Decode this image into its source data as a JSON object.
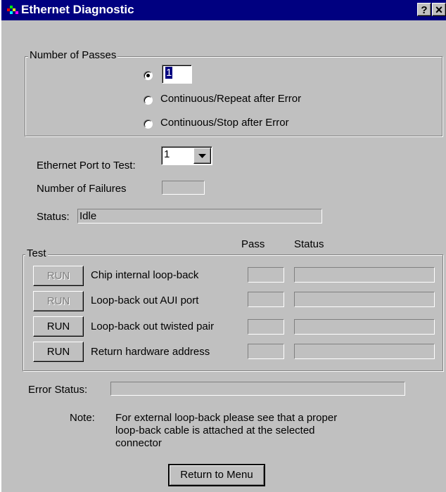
{
  "window": {
    "title": "Ethernet Diagnostic",
    "help_button": "?",
    "close_button": "×"
  },
  "passes": {
    "legend": "Number of Passes",
    "count_value": "1",
    "options": [
      {
        "label": "",
        "selected": true
      },
      {
        "label": "Continuous/Repeat after Error",
        "selected": false
      },
      {
        "label": "Continuous/Stop after  Error",
        "selected": false
      }
    ]
  },
  "port": {
    "label": "Ethernet Port to Test:",
    "selected": "1"
  },
  "failures": {
    "label": "Number of Failures",
    "value": ""
  },
  "status": {
    "label": "Status:",
    "value": "Idle"
  },
  "test": {
    "legend": "Test",
    "col_pass": "Pass",
    "col_status": "Status",
    "rows": [
      {
        "button": "RUN",
        "enabled": false,
        "label": "Chip internal loop-back",
        "pass": "",
        "status": ""
      },
      {
        "button": "RUN",
        "enabled": false,
        "label": "Loop-back out AUI port",
        "pass": "",
        "status": ""
      },
      {
        "button": "RUN",
        "enabled": true,
        "label": "Loop-back out twisted pair",
        "pass": "",
        "status": ""
      },
      {
        "button": "RUN",
        "enabled": true,
        "label": "Return hardware address",
        "pass": "",
        "status": ""
      }
    ]
  },
  "error_status": {
    "label": "Error Status:",
    "value": ""
  },
  "note": {
    "label": "Note:",
    "lines": [
      "For external loop-back please see that a proper",
      "loop-back cable is attached at the selected",
      "connector"
    ]
  },
  "footer": {
    "return_button": "Return to Menu"
  },
  "colors": {
    "titlebar": "#000080",
    "face": "#c0c0c0",
    "shadow": "#808080",
    "highlight": "#ffffff"
  }
}
